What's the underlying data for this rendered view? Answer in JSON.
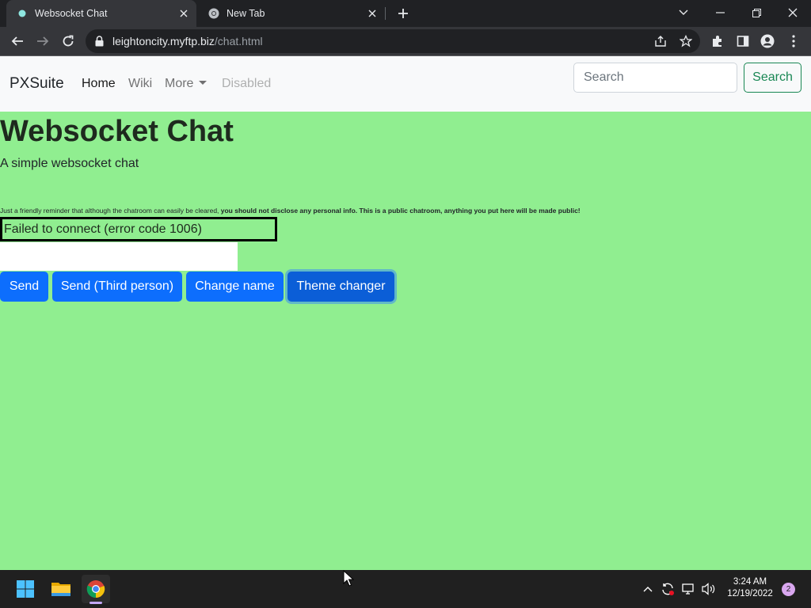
{
  "browser": {
    "tabs": [
      {
        "title": "Websocket Chat",
        "active": true
      },
      {
        "title": "New Tab",
        "active": false
      }
    ],
    "url": {
      "host": "leightoncity.myftp.biz",
      "path": "/chat.html"
    },
    "icons": [
      "back-icon",
      "forward-icon",
      "reload-icon",
      "lock-icon",
      "share-icon",
      "bookmark-star-icon",
      "extensions-icon",
      "side-panel-icon",
      "profile-icon",
      "menu-icon"
    ]
  },
  "navbar": {
    "brand": "PXSuite",
    "links": {
      "home": "Home",
      "wiki": "Wiki",
      "more": "More",
      "disabled": "Disabled"
    },
    "search_placeholder": "Search",
    "search_button": "Search"
  },
  "main": {
    "title": "Websocket Chat",
    "subtitle": "A simple websocket chat",
    "reminder_normal": "Just a friendly reminder that although the chatroom can easily be cleared, ",
    "reminder_bold": "you should not disclose any personal info. This is a public chatroom, anything you put here will be made public!",
    "status": "Failed to connect (error code 1006)",
    "message_value": "",
    "buttons": {
      "send": "Send",
      "send_third": "Send (Third person)",
      "change_name": "Change name",
      "theme": "Theme changer"
    }
  },
  "taskbar": {
    "time": "3:24 AM",
    "date": "12/19/2022",
    "notifications": "2"
  },
  "colors": {
    "page_background": "#90ee90",
    "primary_button": "#0d6efd",
    "outline_success": "#198754"
  }
}
